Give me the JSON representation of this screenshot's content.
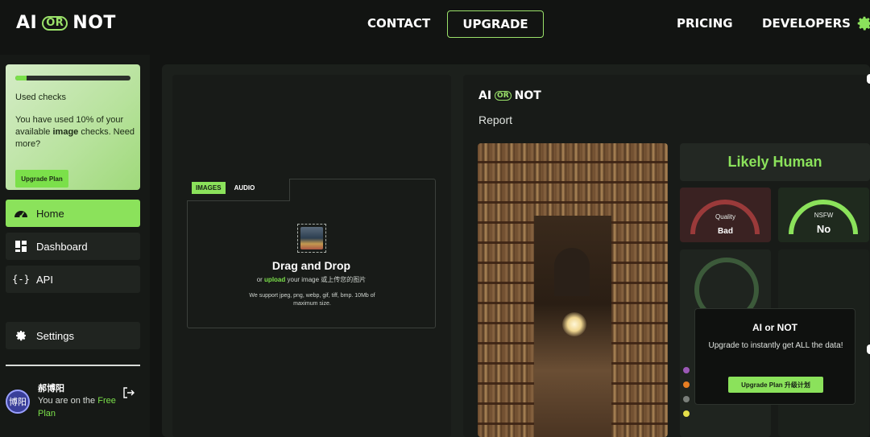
{
  "brand": {
    "left": "AI",
    "or": "OR",
    "right": "NOT"
  },
  "nav": {
    "contact": "CONTACT",
    "upgrade": "UPGRADE",
    "pricing": "PRICING",
    "developers": "DEVELOPERS"
  },
  "usage": {
    "label": "Used checks",
    "progress": 0.1,
    "text_before": "You have used 10% of your available ",
    "text_bold": "image",
    "text_after": " checks. Need more?",
    "button": "Upgrade Plan"
  },
  "sidebar": {
    "items": [
      {
        "label": "Home",
        "icon": "gauge-icon"
      },
      {
        "label": "Dashboard",
        "icon": "dashboard-icon"
      },
      {
        "label": "API",
        "icon": "code-braces-icon"
      },
      {
        "label": "Settings",
        "icon": "gear-icon"
      }
    ]
  },
  "user": {
    "avatar_text": "博阳",
    "name": "郝博阳",
    "plan_prefix": "You are on the ",
    "plan_name": "Free Plan"
  },
  "upload": {
    "tabs": [
      "IMAGES",
      "AUDIO"
    ],
    "title": "Drag and Drop",
    "sub_prefix": "or ",
    "sub_link": "upload",
    "sub_suffix": " your image  或上传您的图片",
    "note": "We support jpeg, png, webp, gif, tiff, bmp. 10Mb of maximum size."
  },
  "report": {
    "brand_left": "AI",
    "brand_or": "OR",
    "brand_right": "NOT",
    "title": "Report",
    "result": "Likely Human",
    "quality_label": "Quality",
    "quality_value": "Bad",
    "nsfw_label": "NSFW",
    "nsfw_value": "No",
    "popup_title": "AI or NOT",
    "popup_text": "Upgrade to instantly get ALL the data!",
    "popup_button": "Upgrade Plan  升级计划"
  },
  "colors": {
    "accent": "#8be25b",
    "background": "#121412",
    "quality_bad": "#3a2222"
  }
}
